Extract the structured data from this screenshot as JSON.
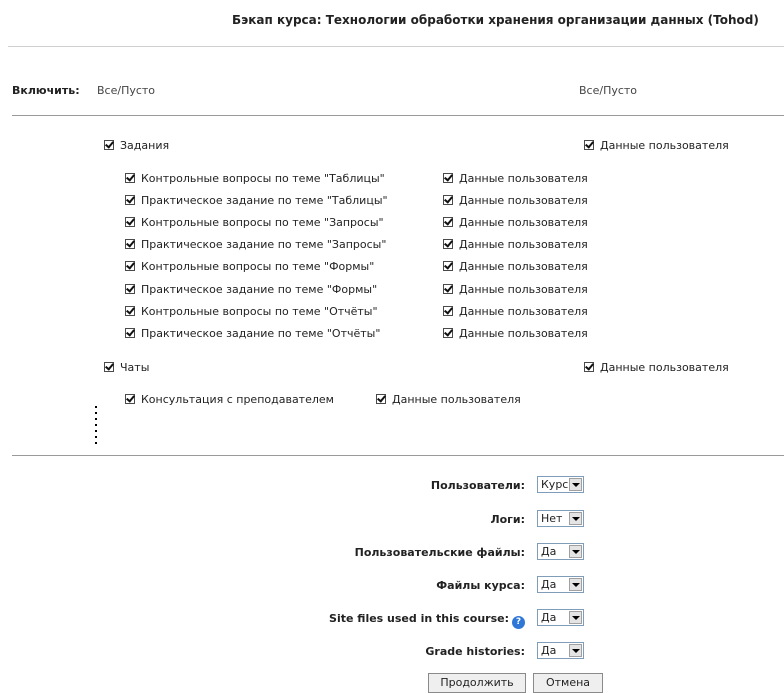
{
  "page": {
    "title": "Бэкап курса: Технологии обработки хранения организации данных (Tohod)"
  },
  "include": {
    "label": "Включить:",
    "all_none_left": "Все/Пусто",
    "all_none_right": "Все/Пусто"
  },
  "modules": [
    {
      "name": "Задания",
      "userdata": "Данные пользователя",
      "items": [
        {
          "name": "Контрольные вопросы по теме \"Таблицы\"",
          "userdata": "Данные пользователя"
        },
        {
          "name": "Практическое задание по теме \"Таблицы\"",
          "userdata": "Данные пользователя"
        },
        {
          "name": "Контрольные вопросы по теме \"Запросы\"",
          "userdata": "Данные пользователя"
        },
        {
          "name": "Практическое задание по теме \"Запросы\"",
          "userdata": "Данные пользователя"
        },
        {
          "name": "Контрольные вопросы по теме \"Формы\"",
          "userdata": "Данные пользователя"
        },
        {
          "name": "Практическое задание по теме \"Формы\"",
          "userdata": "Данные пользователя"
        },
        {
          "name": "Контрольные вопросы по теме \"Отчёты\"",
          "userdata": "Данные пользователя"
        },
        {
          "name": "Практическое задание по теме \"Отчёты\"",
          "userdata": "Данные пользователя"
        }
      ]
    },
    {
      "name": "Чаты",
      "userdata": "Данные пользователя",
      "items": [
        {
          "name": "Консультация с преподавателем",
          "userdata": "Данные пользователя"
        }
      ]
    }
  ],
  "options": [
    {
      "label": "Пользователи:",
      "value": "Курс"
    },
    {
      "label": "Логи:",
      "value": "Нет"
    },
    {
      "label": "Пользовательские файлы:",
      "value": "Да"
    },
    {
      "label": "Файлы курса:",
      "value": "Да"
    },
    {
      "label": "Site files used in this course:",
      "value": "Да",
      "help": "?"
    },
    {
      "label": "Grade histories:",
      "value": "Да"
    }
  ],
  "buttons": {
    "continue": "Продолжить",
    "cancel": "Отмена"
  }
}
